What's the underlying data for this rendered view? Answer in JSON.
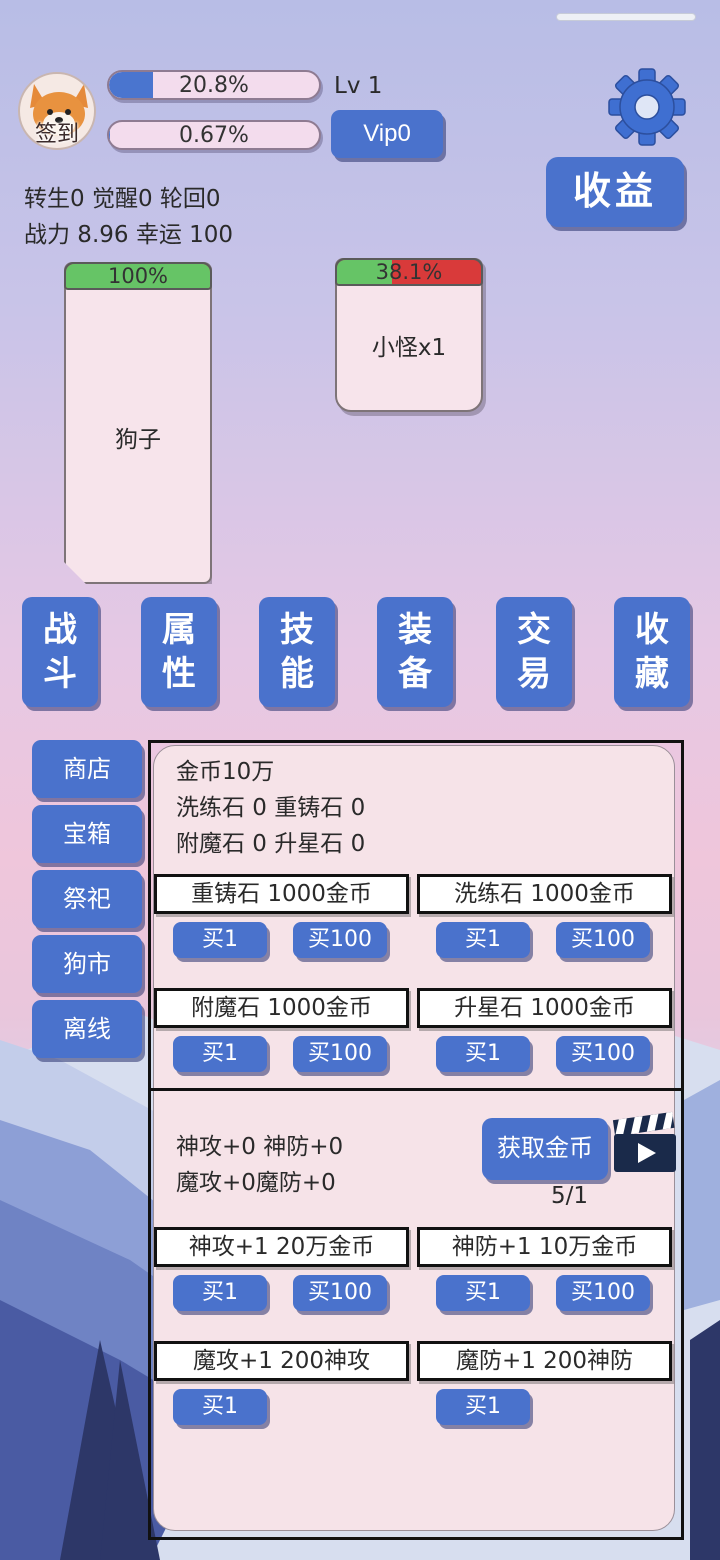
{
  "profile": {
    "avatar_label": "签到",
    "exp_bar": {
      "text": "20.8%",
      "fill": 0.208
    },
    "vip_bar": {
      "text": "0.67%",
      "fill": 0.0067
    },
    "level": "Lv 1",
    "vip_button": "Vip0",
    "income_button": "收益"
  },
  "stats": {
    "line1": "转生0 觉醒0 轮回0",
    "line2": "战力 8.96  幸运 100"
  },
  "battle": {
    "player": {
      "name": "狗子",
      "hp_text": "100%",
      "hp_fill": 1.0
    },
    "enemy": {
      "name": "小怪x1",
      "hp_text": "38.1%",
      "hp_fill": 0.381
    }
  },
  "tabs": [
    {
      "label": "战斗"
    },
    {
      "label": "属性"
    },
    {
      "label": "技能"
    },
    {
      "label": "装备"
    },
    {
      "label": "交易"
    },
    {
      "label": "收藏"
    }
  ],
  "sidebar": [
    {
      "label": "商店"
    },
    {
      "label": "宝箱"
    },
    {
      "label": "祭祀"
    },
    {
      "label": "狗市"
    },
    {
      "label": "离线"
    }
  ],
  "shop": {
    "gold": "金币10万",
    "stones_line1": "洗练石 0 重铸石 0",
    "stones_line2": "附魔石 0 升星石 0",
    "items": [
      {
        "label": "重铸石  1000金币",
        "buy1": "买1",
        "buy100": "买100"
      },
      {
        "label": "洗练石  1000金币",
        "buy1": "买1",
        "buy100": "买100"
      },
      {
        "label": "附魔石  1000金币",
        "buy1": "买1",
        "buy100": "买100"
      },
      {
        "label": "升星石  1000金币",
        "buy1": "买1",
        "buy100": "买100"
      }
    ]
  },
  "divine": {
    "line1": "神攻+0 神防+0",
    "line2": "魔攻+0魔防+0",
    "get_gold_button": "获取金币",
    "ad_count": "5/1",
    "items": [
      {
        "label": "神攻+1  20万金币",
        "buy1": "买1",
        "buy100": "买100"
      },
      {
        "label": "神防+1  10万金币",
        "buy1": "买1",
        "buy100": "买100"
      },
      {
        "label": "魔攻+1 200神攻",
        "buy1": "买1"
      },
      {
        "label": "魔防+1 200神防",
        "buy1": "买1"
      }
    ]
  },
  "colors": {
    "button_blue": "#4a72cc",
    "hp_green": "#66c466",
    "hp_red": "#d93a3a",
    "panel_bg": "#f6e3e8"
  }
}
